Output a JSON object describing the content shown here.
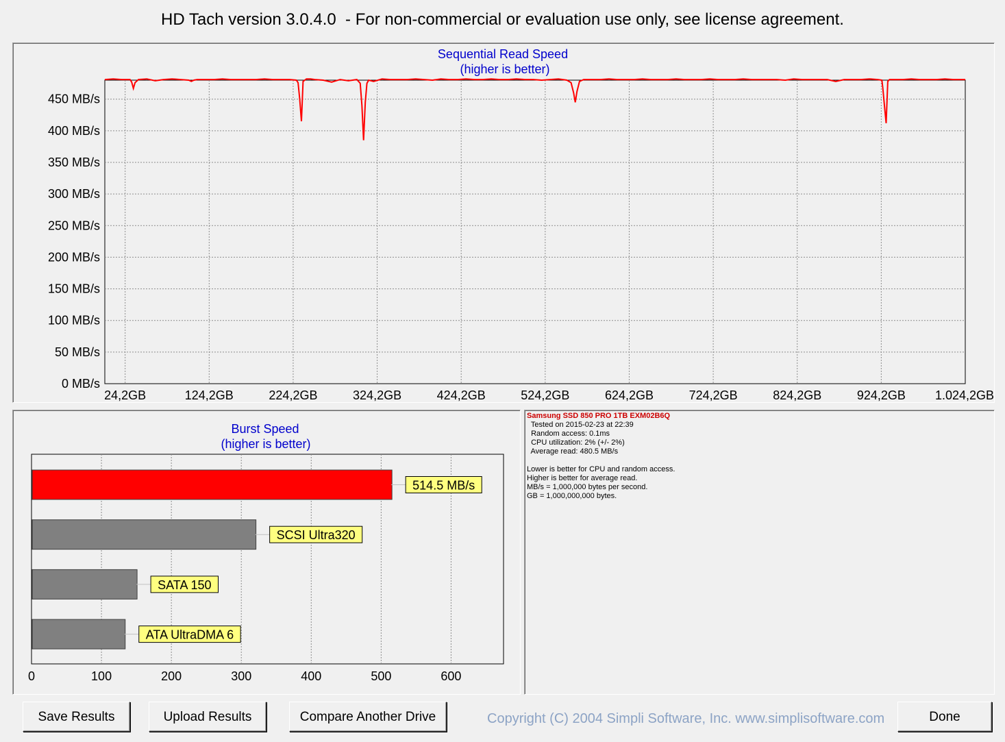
{
  "window": {
    "title": "HD Tach version 3.0.4.0  - For non-commercial or evaluation use only, see license agreement."
  },
  "sequential": {
    "title": "Sequential Read Speed",
    "subtitle": "(higher is better)",
    "colors": {
      "line": "#ff0000",
      "grid": "#8c8c8c"
    }
  },
  "burst": {
    "title": "Burst Speed",
    "subtitle": "(higher is better)"
  },
  "chart_data": [
    {
      "type": "line",
      "title": "Sequential Read Speed",
      "subtitle": "(higher is better)",
      "xlabel": "",
      "ylabel": "",
      "x_tick_labels": [
        "24,2GB",
        "124,2GB",
        "224,2GB",
        "324,2GB",
        "424,2GB",
        "524,2GB",
        "624,2GB",
        "724,2GB",
        "824,2GB",
        "924,2GB",
        "1.024,2GB"
      ],
      "y_tick_labels": [
        "0 MB/s",
        "50 MB/s",
        "100 MB/s",
        "150 MB/s",
        "200 MB/s",
        "250 MB/s",
        "300 MB/s",
        "350 MB/s",
        "400 MB/s",
        "450 MB/s"
      ],
      "xlim": [
        0,
        1024.2
      ],
      "ylim": [
        0,
        480
      ],
      "grid": true,
      "series": [
        {
          "color": "#ff0000",
          "x": [
            0,
            10,
            20,
            30,
            32,
            34,
            36,
            40,
            50,
            60,
            70,
            80,
            90,
            100,
            103,
            106,
            110,
            120,
            130,
            140,
            150,
            160,
            170,
            180,
            190,
            200,
            210,
            220,
            228,
            230,
            232,
            234,
            236,
            240,
            245,
            250,
            260,
            270,
            280,
            290,
            300,
            304,
            306,
            308,
            310,
            312,
            314,
            320,
            330,
            340,
            350,
            360,
            370,
            380,
            390,
            400,
            410,
            420,
            430,
            440,
            450,
            460,
            470,
            480,
            490,
            500,
            510,
            520,
            540,
            550,
            555,
            558,
            560,
            562,
            565,
            570,
            580,
            590,
            600,
            610,
            620,
            630,
            640,
            650,
            660,
            670,
            680,
            690,
            700,
            710,
            720,
            730,
            740,
            750,
            760,
            770,
            780,
            790,
            800,
            810,
            820,
            830,
            840,
            850,
            860,
            870,
            880,
            890,
            900,
            910,
            920,
            925,
            926,
            928,
            930,
            932,
            934,
            940,
            950,
            960,
            970,
            980,
            990,
            1000,
            1010,
            1024.2
          ],
          "y": [
            481,
            482,
            481,
            481,
            477,
            467,
            476,
            481,
            482,
            479,
            481,
            482,
            481,
            480,
            478,
            480,
            481,
            481,
            481,
            482,
            481,
            481,
            481,
            481,
            482,
            481,
            481,
            481,
            480,
            476,
            450,
            415,
            478,
            482,
            482,
            481,
            480,
            477,
            481,
            479,
            481,
            475,
            440,
            385,
            445,
            475,
            480,
            478,
            482,
            481,
            481,
            481,
            482,
            481,
            480,
            482,
            481,
            481,
            482,
            481,
            481,
            482,
            481,
            481,
            482,
            481,
            481,
            480,
            482,
            480,
            476,
            460,
            445,
            462,
            478,
            481,
            481,
            481,
            482,
            481,
            481,
            481,
            482,
            481,
            481,
            481,
            482,
            481,
            481,
            481,
            482,
            481,
            481,
            481,
            482,
            481,
            481,
            481,
            481,
            480,
            482,
            481,
            481,
            481,
            481,
            478,
            481,
            481,
            481,
            482,
            481,
            480,
            468,
            440,
            412,
            478,
            481,
            481,
            481,
            482,
            481,
            481,
            481,
            482,
            481,
            481
          ]
        }
      ]
    },
    {
      "type": "bar",
      "orientation": "horizontal",
      "title": "Burst Speed",
      "subtitle": "(higher is better)",
      "categories": [
        "514.5 MB/s",
        "SCSI Ultra320",
        "SATA 150",
        "ATA UltraDMA 6"
      ],
      "values": [
        514.5,
        320,
        150,
        133
      ],
      "colors": [
        "#ff0000",
        "#808080",
        "#808080",
        "#808080"
      ],
      "x_tick_labels": [
        "0",
        "100",
        "200",
        "300",
        "400",
        "500",
        "600"
      ],
      "xlim": [
        0,
        675
      ],
      "grid": true,
      "label_color": "#ffff80"
    }
  ],
  "info": {
    "heading": "Samsung SSD 850 PRO 1TB EXM02B6Q",
    "lines": [
      "  Tested on 2015-02-23 at 22:39",
      "  Random access: 0.1ms",
      "  CPU utilization: 2% (+/- 2%)",
      "  Average read: 480.5 MB/s",
      "",
      "Lower is better for CPU and random access.",
      "Higher is better for average read.",
      "MB/s = 1,000,000 bytes per second.",
      "GB = 1,000,000,000 bytes."
    ]
  },
  "buttons": {
    "save": "Save Results",
    "upload": "Upload Results",
    "compare": "Compare Another Drive",
    "done": "Done"
  },
  "footer": {
    "copyright": "Copyright (C) 2004 Simpli Software, Inc. www.simplisoftware.com"
  }
}
